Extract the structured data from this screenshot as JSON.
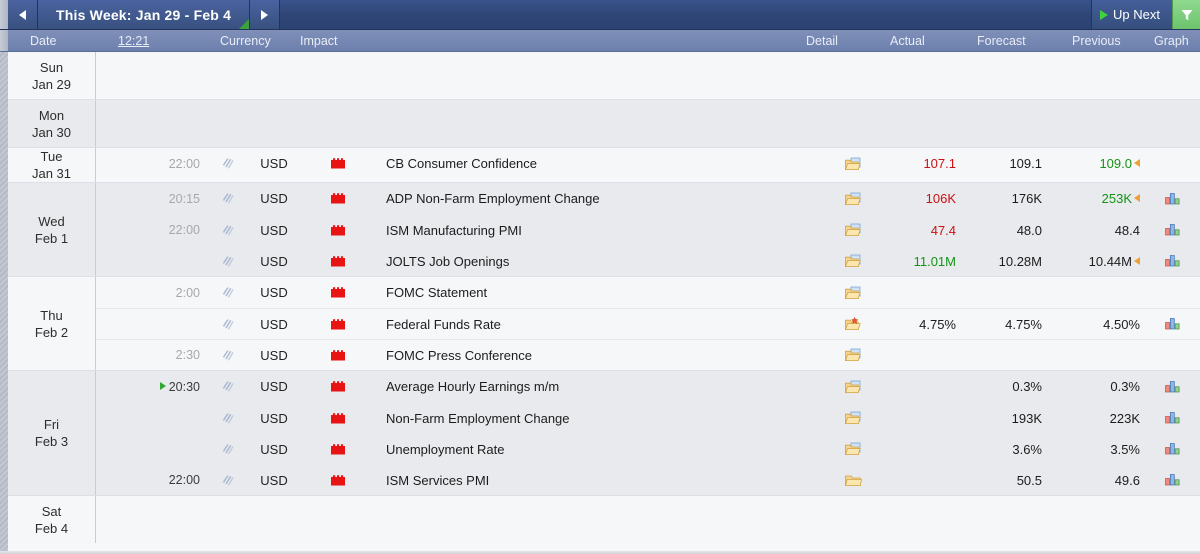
{
  "titlebar": {
    "prev_label": "prev-week",
    "next_label": "next-week",
    "week_range": "This Week: Jan 29 - Feb 4",
    "up_next": "Up Next",
    "filter_label": "filter"
  },
  "columns": {
    "date": "Date",
    "time": "12:21",
    "currency": "Currency",
    "impact": "Impact",
    "detail": "Detail",
    "actual": "Actual",
    "forecast": "Forecast",
    "previous": "Previous",
    "graph": "Graph"
  },
  "colors": {
    "better": "#149414",
    "worse": "#cc1111",
    "neutral": "#1c1c1c",
    "revision_arrow": "#f0a030",
    "impact_high": "#e81313",
    "accent_green": "#6cc46c",
    "titlebar": "#2e4576",
    "header": "#6d80ad"
  },
  "days": [
    {
      "dow": "Sun",
      "date": "Jan 29",
      "shade": "light",
      "events": []
    },
    {
      "dow": "Mon",
      "date": "Jan 30",
      "shade": "dark",
      "events": []
    },
    {
      "dow": "Tue",
      "date": "Jan 31",
      "shade": "light",
      "events": [
        {
          "time": "22:00",
          "time_dark": false,
          "now": false,
          "speaker": "speaker-icon",
          "currency": "USD",
          "impact": "high-impact-icon",
          "impact_color": "#e81313",
          "event": "CB Consumer Confidence",
          "detail_icon": "folder-page-icon",
          "actual": "107.1",
          "actual_state": "worse",
          "forecast": "109.1",
          "previous": "109.0",
          "previous_state": "better",
          "previous_revised": true,
          "graph": false
        }
      ]
    },
    {
      "dow": "Wed",
      "date": "Feb 1",
      "shade": "dark",
      "events": [
        {
          "time": "20:15",
          "time_dark": false,
          "now": false,
          "speaker": "speaker-icon",
          "currency": "USD",
          "impact": "high-impact-icon",
          "impact_color": "#e81313",
          "event": "ADP Non-Farm Employment Change",
          "detail_icon": "folder-page-icon",
          "actual": "106K",
          "actual_state": "worse",
          "forecast": "176K",
          "previous": "253K",
          "previous_state": "better",
          "previous_revised": true,
          "graph": true
        },
        {
          "time": "22:00",
          "time_dark": false,
          "now": false,
          "speaker": "speaker-icon",
          "currency": "USD",
          "impact": "high-impact-icon",
          "impact_color": "#e81313",
          "event": "ISM Manufacturing PMI",
          "detail_icon": "folder-page-icon",
          "actual": "47.4",
          "actual_state": "worse",
          "forecast": "48.0",
          "previous": "48.4",
          "previous_state": "plain",
          "previous_revised": false,
          "graph": true
        },
        {
          "time": "",
          "time_dark": false,
          "now": false,
          "speaker": "speaker-icon",
          "currency": "USD",
          "impact": "high-impact-icon",
          "impact_color": "#e81313",
          "event": "JOLTS Job Openings",
          "detail_icon": "folder-page-icon",
          "actual": "11.01M",
          "actual_state": "better",
          "forecast": "10.28M",
          "previous": "10.44M",
          "previous_state": "plain",
          "previous_revised": true,
          "graph": true
        }
      ]
    },
    {
      "dow": "Thu",
      "date": "Feb 2",
      "shade": "light",
      "events": [
        {
          "time": "2:00",
          "time_dark": false,
          "now": false,
          "speaker": "speaker-icon",
          "currency": "USD",
          "impact": "high-impact-icon",
          "impact_color": "#e81313",
          "event": "FOMC Statement",
          "detail_icon": "folder-page-icon",
          "actual": "",
          "actual_state": "plain",
          "forecast": "",
          "previous": "",
          "previous_state": "plain",
          "previous_revised": false,
          "graph": false
        },
        {
          "time": "",
          "time_dark": false,
          "now": false,
          "speaker": "speaker-icon",
          "currency": "USD",
          "impact": "high-impact-icon",
          "impact_color": "#e81313",
          "event": "Federal Funds Rate",
          "detail_icon": "folder-star-icon",
          "actual": "4.75%",
          "actual_state": "plain",
          "forecast": "4.75%",
          "previous": "4.50%",
          "previous_state": "plain",
          "previous_revised": false,
          "graph": true
        },
        {
          "time": "2:30",
          "time_dark": false,
          "now": false,
          "speaker": "speaker-icon",
          "currency": "USD",
          "impact": "high-impact-icon",
          "impact_color": "#e81313",
          "event": "FOMC Press Conference",
          "detail_icon": "folder-page-icon",
          "actual": "",
          "actual_state": "plain",
          "forecast": "",
          "previous": "",
          "previous_state": "plain",
          "previous_revised": false,
          "graph": false
        }
      ]
    },
    {
      "dow": "Fri",
      "date": "Feb 3",
      "shade": "dark",
      "events": [
        {
          "time": "20:30",
          "time_dark": true,
          "now": true,
          "speaker": "speaker-icon",
          "currency": "USD",
          "impact": "high-impact-icon",
          "impact_color": "#e81313",
          "event": "Average Hourly Earnings m/m",
          "detail_icon": "folder-page-icon",
          "actual": "",
          "actual_state": "plain",
          "forecast": "0.3%",
          "previous": "0.3%",
          "previous_state": "plain",
          "previous_revised": false,
          "graph": true
        },
        {
          "time": "",
          "time_dark": false,
          "now": false,
          "speaker": "speaker-icon",
          "currency": "USD",
          "impact": "high-impact-icon",
          "impact_color": "#e81313",
          "event": "Non-Farm Employment Change",
          "detail_icon": "folder-page-icon",
          "actual": "",
          "actual_state": "plain",
          "forecast": "193K",
          "previous": "223K",
          "previous_state": "plain",
          "previous_revised": false,
          "graph": true
        },
        {
          "time": "",
          "time_dark": false,
          "now": false,
          "speaker": "speaker-icon",
          "currency": "USD",
          "impact": "high-impact-icon",
          "impact_color": "#e81313",
          "event": "Unemployment Rate",
          "detail_icon": "folder-page-icon",
          "actual": "",
          "actual_state": "plain",
          "forecast": "3.6%",
          "previous": "3.5%",
          "previous_state": "plain",
          "previous_revised": false,
          "graph": true
        },
        {
          "time": "22:00",
          "time_dark": true,
          "now": false,
          "speaker": "speaker-icon",
          "currency": "USD",
          "impact": "high-impact-icon",
          "impact_color": "#e81313",
          "event": "ISM Services PMI",
          "detail_icon": "folder-plain-icon",
          "actual": "",
          "actual_state": "plain",
          "forecast": "50.5",
          "previous": "49.6",
          "previous_state": "plain",
          "previous_revised": false,
          "graph": true
        }
      ]
    },
    {
      "dow": "Sat",
      "date": "Feb 4",
      "shade": "light",
      "events": []
    }
  ]
}
